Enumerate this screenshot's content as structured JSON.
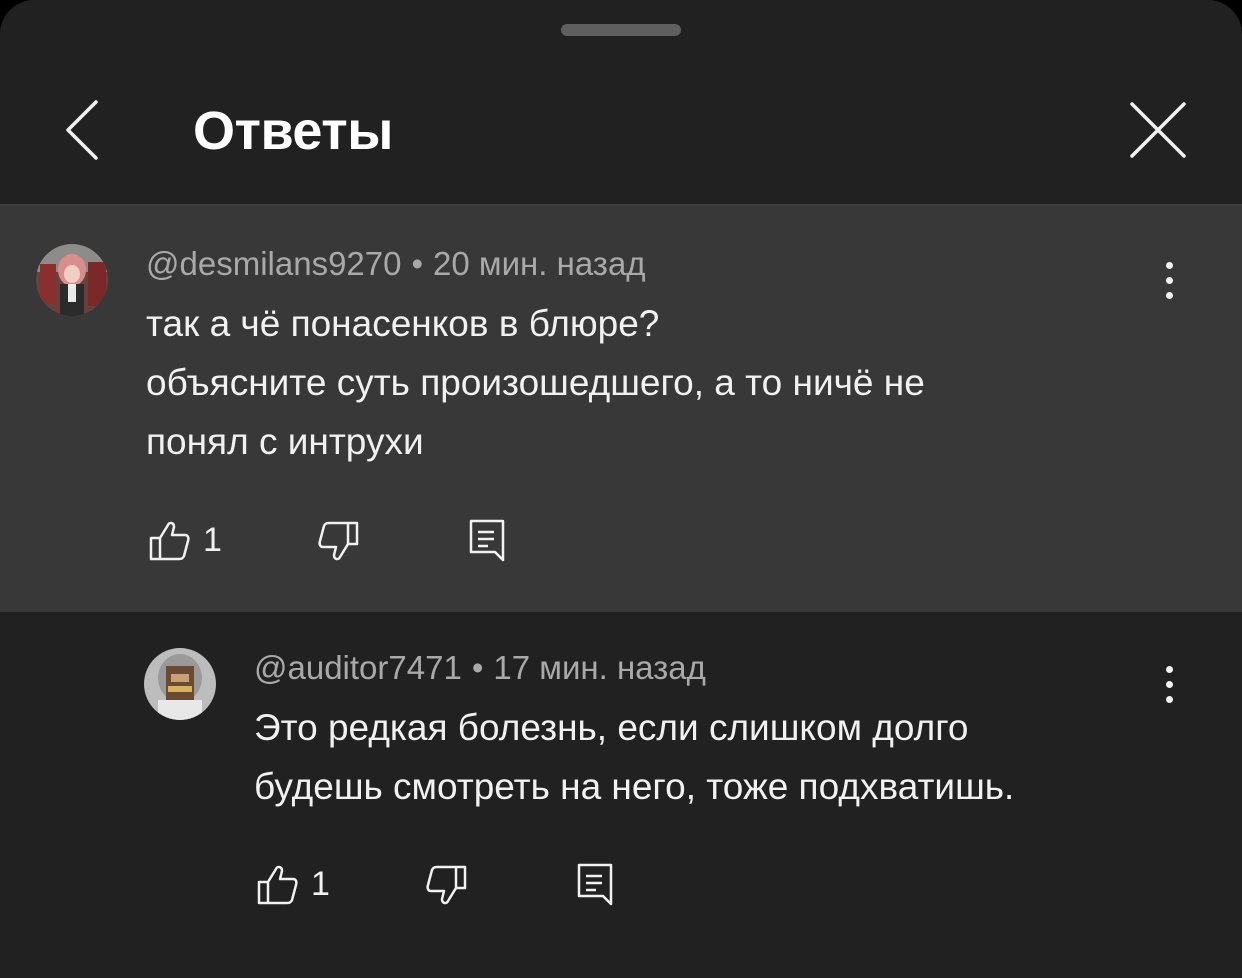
{
  "header": {
    "title": "Ответы"
  },
  "comments": [
    {
      "author": "@desmilans9270",
      "separator": "•",
      "time": "20 мин. назад",
      "lines": [
        "так а чё понасенков в блюре?",
        "объясните суть произошедшего, а то ничё не",
        "понял с интрухи"
      ],
      "likes": "1",
      "highlighted": true
    },
    {
      "author": "@auditor7471",
      "separator": "•",
      "time": "17 мин. назад",
      "lines": [
        "Это редкая болезнь, если слишком долго",
        "будешь смотреть на него, тоже подхватишь."
      ],
      "likes": "1",
      "highlighted": false
    }
  ],
  "icons": {
    "back": "chevron-left-icon",
    "close": "close-icon",
    "more": "more-vertical-icon",
    "like": "thumb-up-icon",
    "dislike": "thumb-down-icon",
    "reply": "reply-comment-icon"
  },
  "colors": {
    "sheet_bg": "#212121",
    "highlight_bg": "#383838",
    "meta_text": "#a9a9a9",
    "text": "#f1f1f1"
  }
}
